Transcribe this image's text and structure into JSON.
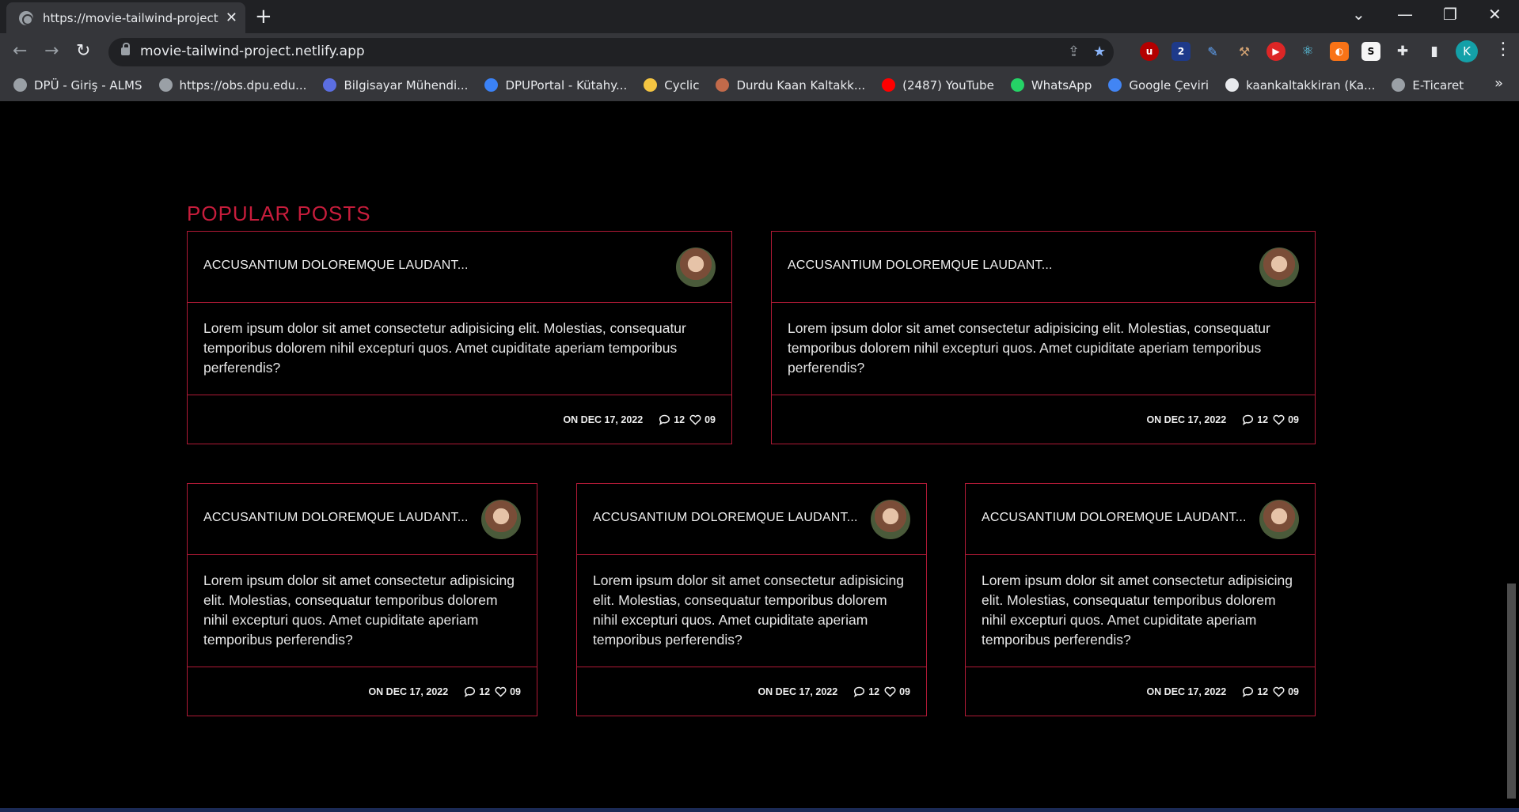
{
  "browser": {
    "tab_title": "https://movie-tailwind-project.netlify.app",
    "url": "movie-tailwind-project.netlify.app",
    "profile_initial": "K",
    "bookmarks": [
      {
        "label": "DPÜ - Giriş - ALMS",
        "color": "#9aa0a6"
      },
      {
        "label": "https://obs.dpu.edu...",
        "color": "#9aa0a6"
      },
      {
        "label": "Bilgisayar Mühendi...",
        "color": "#5b6ee1"
      },
      {
        "label": "DPUPortal - Kütahy...",
        "color": "#3b82f6"
      },
      {
        "label": "Cyclic",
        "color": "#f4c542"
      },
      {
        "label": "Durdu Kaan Kaltakk...",
        "color": "#c26a4a"
      },
      {
        "label": "(2487) YouTube",
        "color": "#ff0000"
      },
      {
        "label": "WhatsApp",
        "color": "#25d366"
      },
      {
        "label": "Google Çeviri",
        "color": "#4285f4"
      },
      {
        "label": "kaankaltakkiran (Ka...",
        "color": "#e8eaed"
      },
      {
        "label": "E-Ticaret",
        "color": "#9aa0a6"
      }
    ],
    "more_bookmarks": "»"
  },
  "section": {
    "title": "POPULAR POSTS"
  },
  "posts": [
    {
      "title": "ACCUSANTIUM DOLOREMQUE LAUDANT...",
      "body": "Lorem ipsum dolor sit amet consectetur adipisicing elit. Molestias, consequatur temporibus dolorem nihil excepturi quos. Amet cupiditate aperiam temporibus perferendis?",
      "date": "ON DEC 17, 2022",
      "comments": "12",
      "likes": "09"
    },
    {
      "title": "ACCUSANTIUM DOLOREMQUE LAUDANT...",
      "body": "Lorem ipsum dolor sit amet consectetur adipisicing elit. Molestias, consequatur temporibus dolorem nihil excepturi quos. Amet cupiditate aperiam temporibus perferendis?",
      "date": "ON DEC 17, 2022",
      "comments": "12",
      "likes": "09"
    },
    {
      "title": "ACCUSANTIUM DOLOREMQUE LAUDANT...",
      "body": "Lorem ipsum dolor sit amet consectetur adipisicing elit. Molestias, consequatur temporibus dolorem nihil excepturi quos. Amet cupiditate aperiam temporibus perferendis?",
      "date": "ON DEC 17, 2022",
      "comments": "12",
      "likes": "09"
    },
    {
      "title": "ACCUSANTIUM DOLOREMQUE LAUDANT...",
      "body": "Lorem ipsum dolor sit amet consectetur adipisicing elit. Molestias, consequatur temporibus dolorem nihil excepturi quos. Amet cupiditate aperiam temporibus perferendis?",
      "date": "ON DEC 17, 2022",
      "comments": "12",
      "likes": "09"
    },
    {
      "title": "ACCUSANTIUM DOLOREMQUE LAUDANT...",
      "body": "Lorem ipsum dolor sit amet consectetur adipisicing elit. Molestias, consequatur temporibus dolorem nihil excepturi quos. Amet cupiditate aperiam temporibus perferendis?",
      "date": "ON DEC 17, 2022",
      "comments": "12",
      "likes": "09"
    }
  ],
  "colors": {
    "accent": "#c81d3c",
    "border": "#b01a36",
    "background": "#000000"
  }
}
